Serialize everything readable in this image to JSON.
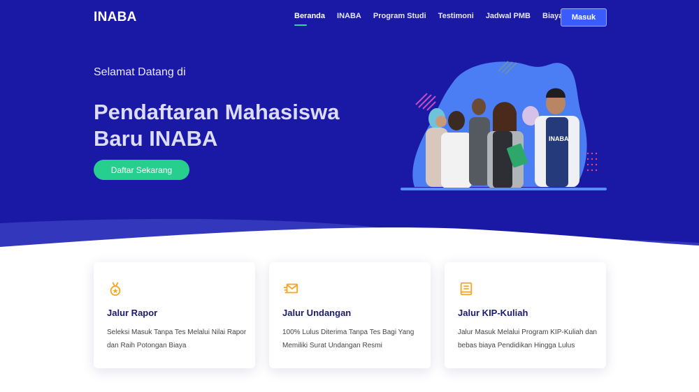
{
  "navbar": {
    "brand": "INABA",
    "links": [
      "Beranda",
      "INABA",
      "Program Studi",
      "Testimoni",
      "Jadwal PMB",
      "Biaya"
    ],
    "active_link": "Beranda",
    "login_label": "Masuk"
  },
  "hero": {
    "welcome": "Selamat Datang di",
    "headline": "Pendaftaran Mahasiswa Baru INABA",
    "cta_label": "Daftar Sekarang"
  },
  "cards": [
    {
      "icon": "medal-icon",
      "title": "Jalur Rapor",
      "description": "Seleksi Masuk Tanpa Tes Melalui Nilai Rapor dan Raih Potongan Biaya"
    },
    {
      "icon": "envelope-send-icon",
      "title": "Jalur Undangan",
      "description": "100% Lulus Diterima Tanpa Tes Bagi Yang Memiliki Surat Undangan Resmi"
    },
    {
      "icon": "book-icon",
      "title": "Jalur KIP-Kuliah",
      "description": "Jalur Masuk Melalui Program KIP-Kuliah dan bebas biaya Pendidikan Hingga Lulus"
    }
  ],
  "colors": {
    "hero_bg": "#1a19a6",
    "accent_green": "#27cf8e",
    "button_blue": "#3a5cff",
    "icon_orange": "#f5a623"
  }
}
